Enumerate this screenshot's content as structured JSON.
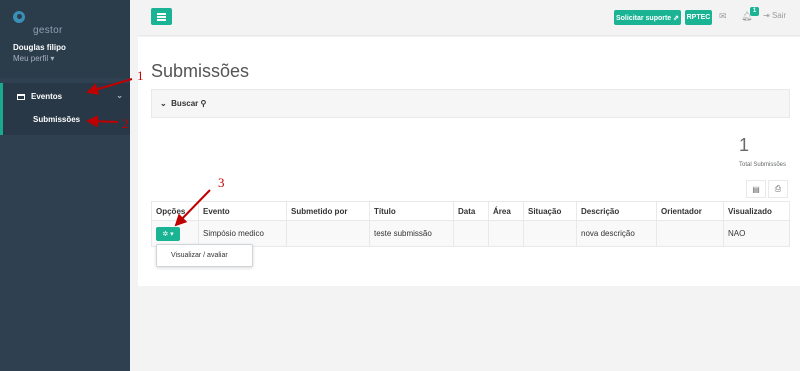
{
  "sidebar": {
    "logo_text": "gestor",
    "user_name": "Douglas filipo",
    "profile_link": "Meu perfil ▾",
    "nav_eventos": "Eventos",
    "nav_submissoes": "Submissões"
  },
  "topbar": {
    "support_label": "Solicitar suporte ⇗",
    "rptec_label": "RPTEC",
    "notification_count": "1",
    "logout_label": "Sair"
  },
  "main": {
    "title": "Submissões",
    "search_label": "Buscar",
    "total_count": "1",
    "total_label": "Total Submissões"
  },
  "table": {
    "headers": [
      "Opções",
      "Evento",
      "Submetido por",
      "Título",
      "Data",
      "Área",
      "Situação",
      "Descrição",
      "Orientador",
      "Visualizado"
    ],
    "row": [
      "",
      "Simpósio medico",
      "",
      "teste submissão",
      "",
      "",
      "",
      "nova descrição",
      "",
      "NAO"
    ]
  },
  "dropdown": {
    "item": "Visualizar / avaliar"
  },
  "annotations": [
    "1",
    "2",
    "3"
  ],
  "colors": {
    "accent": "#1ab394",
    "sidebar": "#2f4050",
    "annotation": "#c00000"
  }
}
